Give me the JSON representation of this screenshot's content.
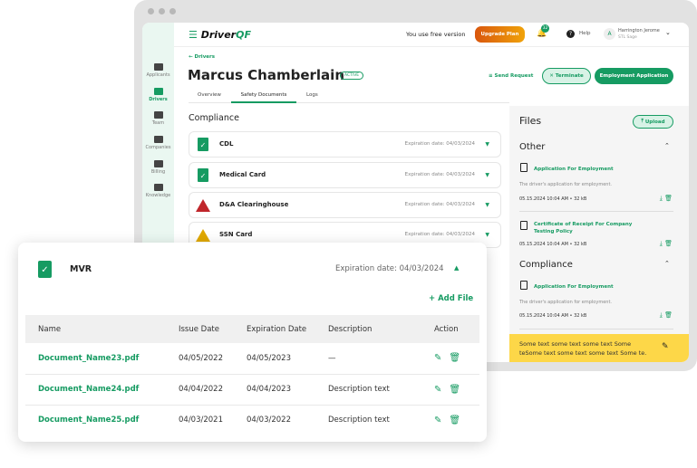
{
  "app": {
    "brand_prefix": "Driver",
    "brand_suffix": "QF",
    "free_text": "You use free version",
    "upgrade_label": "Upgrade Plan",
    "notif_count": "32",
    "help_label": "Help",
    "user_initial": "A",
    "user_name": "Harrington Jerome",
    "user_company": "STL Sage"
  },
  "sidebar": {
    "items": [
      {
        "label": "Applicants"
      },
      {
        "label": "Drivers"
      },
      {
        "label": "Team"
      },
      {
        "label": "Companies"
      },
      {
        "label": "Billing"
      },
      {
        "label": "Knowledge"
      }
    ]
  },
  "page": {
    "breadcrumb": "Drivers",
    "title": "Marcus Chamberlain",
    "status": "ACTIVE",
    "send_request": "Send Request",
    "terminate": "Terminate",
    "employment_app": "Employment Application",
    "tabs": [
      {
        "label": "Overview"
      },
      {
        "label": "Safety Documents"
      },
      {
        "label": "Logs"
      }
    ],
    "section": "Compliance",
    "docs": [
      {
        "name": "CDL",
        "exp": "Expiration date: 04/03/2024",
        "status": "valid"
      },
      {
        "name": "Medical Card",
        "exp": "Expiration date: 04/03/2024",
        "status": "valid"
      },
      {
        "name": "D&A Clearinghouse",
        "exp": "Expiration date: 04/03/2024",
        "status": "error"
      },
      {
        "name": "SSN Card",
        "exp": "Expiration date: 04/03/2024",
        "status": "warning"
      }
    ]
  },
  "files": {
    "title": "Files",
    "upload": "Upload",
    "other": {
      "title": "Other",
      "items": [
        {
          "name": "Application For Employment",
          "desc": "The driver's application for employment.",
          "meta": "05.15.2024 10:04 AM • 32 kB"
        },
        {
          "name": "Certificate of Receipt For Company Testing Policy",
          "meta": "05.15.2024 10:04 AM • 32 kB"
        }
      ]
    },
    "compliance": {
      "title": "Compliance",
      "items": [
        {
          "name": "Application For Employment",
          "desc": "The driver's application for employment.",
          "meta": "05.15.2024 10:04 AM • 32 kB"
        }
      ]
    },
    "note": "Some text some text some text Some teSome text some text some text Some te."
  },
  "mvr": {
    "name": "MVR",
    "exp": "Expiration date: 04/03/2024",
    "add_file": "+ Add File",
    "columns": [
      "Name",
      "Issue Date",
      "Expiration Date",
      "Description",
      "Action"
    ],
    "rows": [
      {
        "name": "Document_Name23.pdf",
        "issue": "04/05/2022",
        "exp": "04/05/2023",
        "desc": "—"
      },
      {
        "name": "Document_Name24.pdf",
        "issue": "04/04/2022",
        "exp": "04/04/2023",
        "desc": "Description text"
      },
      {
        "name": "Document_Name25.pdf",
        "issue": "04/03/2021",
        "exp": "04/03/2022",
        "desc": "Description text"
      }
    ]
  },
  "colors": {
    "accent": "#169b62",
    "error": "#c0262b",
    "warning": "#e0a800",
    "note": "#fdd748",
    "upgrade": "#e06a0c"
  }
}
